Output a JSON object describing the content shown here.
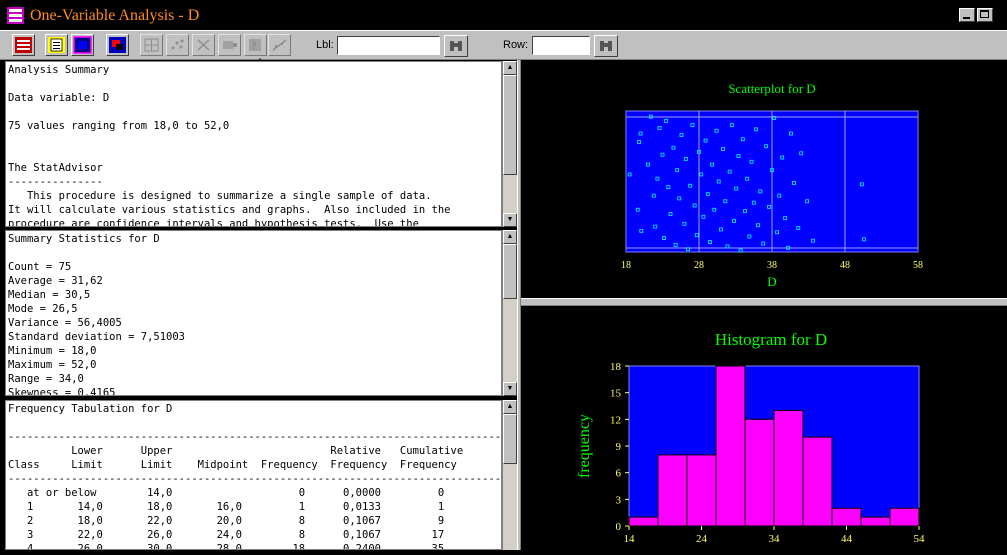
{
  "window": {
    "title": "One-Variable Analysis - D"
  },
  "toolbar": {
    "lbl_label": "Lbl:",
    "lbl_value": "",
    "row_label": "Row:",
    "row_value": ""
  },
  "panes": {
    "analysis_summary": "Analysis Summary\n\nData variable: D\n\n75 values ranging from 18,0 to 52,0\n\n\nThe StatAdvisor\n---------------\n   This procedure is designed to summarize a single sample of data.\nIt will calculate various statistics and graphs.  Also included in the\nprocedure are confidence intervals and hypothesis tests.  Use the",
    "summary_statistics": "Summary Statistics for D\n\nCount = 75\nAverage = 31,62\nMedian = 30,5\nMode = 26,5\nVariance = 56,4005\nStandard deviation = 7,51003\nMinimum = 18,0\nMaximum = 52,0\nRange = 34,0\nSkewness = 0,4165",
    "frequency_tabulation": "Frequency Tabulation for D\n\n--------------------------------------------------------------------------------\n          Lower      Upper                         Relative   Cumulative\nClass     Limit      Limit    Midpoint  Frequency  Frequency  Frequency\n--------------------------------------------------------------------------------\n   at or below        14,0                    0      0,0000         0\n   1       14,0       18,0       16,0         1      0,0133         1\n   2       18,0       22,0       20,0         8      0,1067         9\n   3       22,0       26,0       24,0         8      0,1067        17\n   4       26,0       30,0       28,0        18      0,2400        35"
  },
  "colors": {
    "plot_bg": "#0000ff",
    "text_green": "#00ff00",
    "tick_yellow": "#ffff66",
    "histogram_bar": "#ff00ff",
    "scatter_point": "#00ffff",
    "title_orange": "#ff8c1a"
  },
  "chart_data": [
    {
      "type": "scatter",
      "title": "Scatterplot for D",
      "xlabel": "D",
      "xticks": [
        "18",
        "28",
        "38",
        "48",
        "58"
      ],
      "xlim": [
        18,
        58
      ],
      "ylim": [
        0,
        1
      ],
      "grid": true,
      "points": [
        [
          18.5,
          0.55
        ],
        [
          19.6,
          0.3
        ],
        [
          19.8,
          0.78
        ],
        [
          20.0,
          0.84
        ],
        [
          20.1,
          0.15
        ],
        [
          21.0,
          0.62
        ],
        [
          21.4,
          0.96
        ],
        [
          21.8,
          0.4
        ],
        [
          22.0,
          0.18
        ],
        [
          22.3,
          0.52
        ],
        [
          22.6,
          0.88
        ],
        [
          23.0,
          0.69
        ],
        [
          23.2,
          0.1
        ],
        [
          23.5,
          0.93
        ],
        [
          23.8,
          0.46
        ],
        [
          24.1,
          0.27
        ],
        [
          24.5,
          0.74
        ],
        [
          24.8,
          0.05
        ],
        [
          25.0,
          0.58
        ],
        [
          25.3,
          0.38
        ],
        [
          25.6,
          0.83
        ],
        [
          26.0,
          0.2
        ],
        [
          26.2,
          0.66
        ],
        [
          26.5,
          0.02
        ],
        [
          26.8,
          0.47
        ],
        [
          27.1,
          0.9
        ],
        [
          27.4,
          0.33
        ],
        [
          27.7,
          0.12
        ],
        [
          28.0,
          0.71
        ],
        [
          28.3,
          0.55
        ],
        [
          28.6,
          0.25
        ],
        [
          28.9,
          0.79
        ],
        [
          29.2,
          0.41
        ],
        [
          29.5,
          0.07
        ],
        [
          29.8,
          0.62
        ],
        [
          30.1,
          0.3
        ],
        [
          30.4,
          0.86
        ],
        [
          30.7,
          0.5
        ],
        [
          31.0,
          0.16
        ],
        [
          31.3,
          0.73
        ],
        [
          31.6,
          0.36
        ],
        [
          31.9,
          0.04
        ],
        [
          32.2,
          0.57
        ],
        [
          32.5,
          0.9
        ],
        [
          32.8,
          0.22
        ],
        [
          33.1,
          0.45
        ],
        [
          33.4,
          0.68
        ],
        [
          33.7,
          0.01
        ],
        [
          34.0,
          0.8
        ],
        [
          34.3,
          0.29
        ],
        [
          34.6,
          0.52
        ],
        [
          34.9,
          0.11
        ],
        [
          35.2,
          0.64
        ],
        [
          35.5,
          0.35
        ],
        [
          35.8,
          0.87
        ],
        [
          36.1,
          0.19
        ],
        [
          36.4,
          0.43
        ],
        [
          36.8,
          0.06
        ],
        [
          37.2,
          0.75
        ],
        [
          37.6,
          0.32
        ],
        [
          38.0,
          0.58
        ],
        [
          38.3,
          0.95
        ],
        [
          38.7,
          0.14
        ],
        [
          39.0,
          0.4
        ],
        [
          39.4,
          0.67
        ],
        [
          39.8,
          0.24
        ],
        [
          40.2,
          0.03
        ],
        [
          40.6,
          0.84
        ],
        [
          41.0,
          0.49
        ],
        [
          41.6,
          0.17
        ],
        [
          42.0,
          0.7
        ],
        [
          42.8,
          0.36
        ],
        [
          43.6,
          0.08
        ],
        [
          50.3,
          0.48
        ],
        [
          50.6,
          0.09
        ]
      ]
    },
    {
      "type": "bar",
      "title": "Histogram for D",
      "ylabel": "frequency",
      "xticks": [
        "14",
        "24",
        "34",
        "44",
        "54"
      ],
      "xlim": [
        14,
        54
      ],
      "ylim": [
        0,
        18
      ],
      "yticks": [
        "0",
        "3",
        "6",
        "9",
        "12",
        "15",
        "18"
      ],
      "bin_edges": [
        14,
        18,
        22,
        26,
        30,
        34,
        38,
        42,
        46,
        50,
        54
      ],
      "values": [
        1,
        8,
        8,
        18,
        12,
        13,
        10,
        2,
        1,
        2
      ]
    }
  ]
}
